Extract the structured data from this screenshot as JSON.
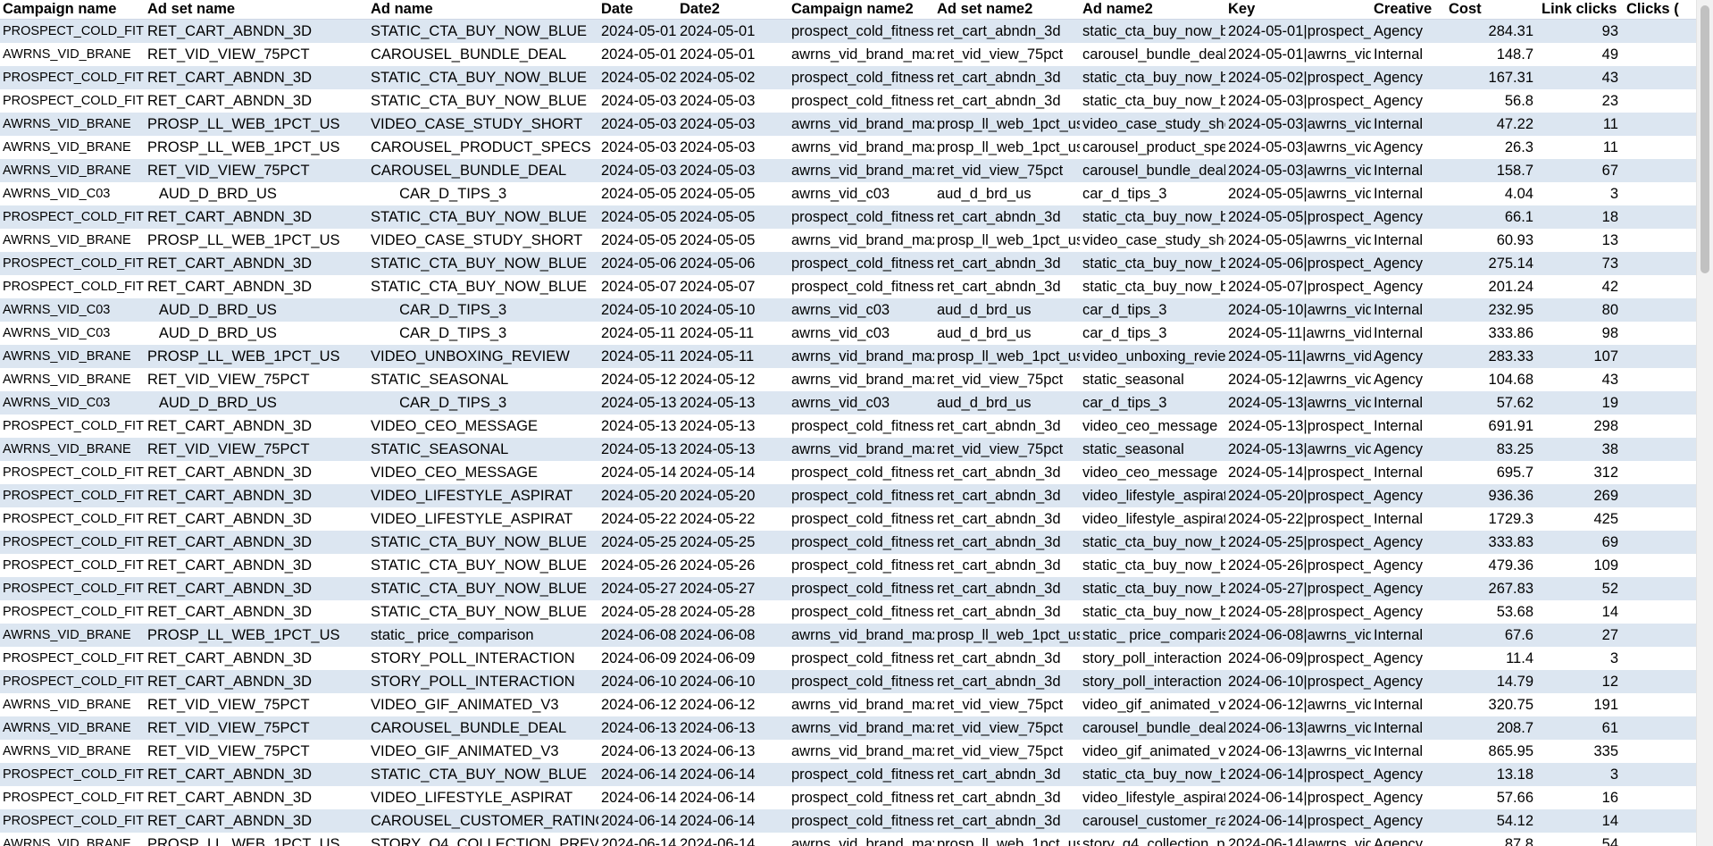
{
  "columns": [
    "Campaign name",
    "Ad set name",
    "Ad name",
    "Date",
    "Date2",
    "Campaign name2",
    "Ad set name2",
    "Ad name2",
    "Key",
    "Creative",
    "Cost",
    "Link clicks",
    "Clicks ("
  ],
  "rows": [
    [
      "PROSPECT_COLD_FITNE",
      "RET_CART_ABNDN_3D",
      "STATIC_CTA_BUY_NOW_BLUE",
      "2024-05-01",
      "2024-05-01",
      "prospect_cold_fitness",
      "ret_cart_abndn_3d",
      "static_cta_buy_now_bl",
      "2024-05-01|prospect_",
      "Agency",
      "284.31",
      "93",
      ""
    ],
    [
      "AWRNS_VID_BRANE",
      "RET_VID_VIEW_75PCT",
      "CAROUSEL_BUNDLE_DEAL",
      "2024-05-01",
      "2024-05-01",
      "awrns_vid_brand_max",
      "ret_vid_view_75pct",
      "carousel_bundle_deal",
      "2024-05-01|awrns_vid",
      "Internal",
      "148.7",
      "49",
      ""
    ],
    [
      "PROSPECT_COLD_FITNE",
      "RET_CART_ABNDN_3D",
      "STATIC_CTA_BUY_NOW_BLUE",
      "2024-05-02",
      "2024-05-02",
      "prospect_cold_fitness",
      "ret_cart_abndn_3d",
      "static_cta_buy_now_bl",
      "2024-05-02|prospect_",
      "Agency",
      "167.31",
      "43",
      ""
    ],
    [
      "PROSPECT_COLD_FITNE",
      "RET_CART_ABNDN_3D",
      "STATIC_CTA_BUY_NOW_BLUE",
      "2024-05-03",
      "2024-05-03",
      "prospect_cold_fitness",
      "ret_cart_abndn_3d",
      "static_cta_buy_now_bl",
      "2024-05-03|prospect_",
      "Agency",
      "56.8",
      "23",
      ""
    ],
    [
      "AWRNS_VID_BRANE",
      "PROSP_LL_WEB_1PCT_US",
      "VIDEO_CASE_STUDY_SHORT",
      "2024-05-03",
      "2024-05-03",
      "awrns_vid_brand_max",
      "prosp_ll_web_1pct_us",
      "video_case_study_shor",
      "2024-05-03|awrns_vid",
      "Internal",
      "47.22",
      "11",
      ""
    ],
    [
      "AWRNS_VID_BRANE",
      "PROSP_LL_WEB_1PCT_US",
      "CAROUSEL_PRODUCT_SPECS",
      "2024-05-03",
      "2024-05-03",
      "awrns_vid_brand_max",
      "prosp_ll_web_1pct_us",
      "carousel_product_spec",
      "2024-05-03|awrns_vid",
      "Agency",
      "26.3",
      "11",
      ""
    ],
    [
      "AWRNS_VID_BRANE",
      "RET_VID_VIEW_75PCT",
      "CAROUSEL_BUNDLE_DEAL",
      "2024-05-03",
      "2024-05-03",
      "awrns_vid_brand_max",
      "ret_vid_view_75pct",
      "carousel_bundle_deal",
      "2024-05-03|awrns_vid",
      "Internal",
      "158.7",
      "67",
      ""
    ],
    [
      "AWRNS_VID_C03",
      "   AUD_D_BRD_US",
      "       CAR_D_TIPS_3",
      "2024-05-05",
      "2024-05-05",
      "awrns_vid_c03",
      "aud_d_brd_us",
      "car_d_tips_3",
      "2024-05-05|awrns_vid",
      "Internal",
      "4.04",
      "3",
      ""
    ],
    [
      "PROSPECT_COLD_FITNE",
      "RET_CART_ABNDN_3D",
      "STATIC_CTA_BUY_NOW_BLUE",
      "2024-05-05",
      "2024-05-05",
      "prospect_cold_fitness",
      "ret_cart_abndn_3d",
      "static_cta_buy_now_bl",
      "2024-05-05|prospect_",
      "Agency",
      "66.1",
      "18",
      ""
    ],
    [
      "AWRNS_VID_BRANE",
      "PROSP_LL_WEB_1PCT_US",
      "VIDEO_CASE_STUDY_SHORT",
      "2024-05-05",
      "2024-05-05",
      "awrns_vid_brand_max",
      "prosp_ll_web_1pct_us",
      "video_case_study_shor",
      "2024-05-05|awrns_vid",
      "Internal",
      "60.93",
      "13",
      ""
    ],
    [
      "PROSPECT_COLD_FITNE",
      "RET_CART_ABNDN_3D",
      "STATIC_CTA_BUY_NOW_BLUE",
      "2024-05-06",
      "2024-05-06",
      "prospect_cold_fitness",
      "ret_cart_abndn_3d",
      "static_cta_buy_now_bl",
      "2024-05-06|prospect_",
      "Agency",
      "275.14",
      "73",
      ""
    ],
    [
      "PROSPECT_COLD_FITNE",
      "RET_CART_ABNDN_3D",
      "STATIC_CTA_BUY_NOW_BLUE",
      "2024-05-07",
      "2024-05-07",
      "prospect_cold_fitness",
      "ret_cart_abndn_3d",
      "static_cta_buy_now_bl",
      "2024-05-07|prospect_",
      "Agency",
      "201.24",
      "42",
      ""
    ],
    [
      "AWRNS_VID_C03",
      "   AUD_D_BRD_US",
      "       CAR_D_TIPS_3",
      "2024-05-10",
      "2024-05-10",
      "awrns_vid_c03",
      "aud_d_brd_us",
      "car_d_tips_3",
      "2024-05-10|awrns_vid",
      "Internal",
      "232.95",
      "80",
      ""
    ],
    [
      "AWRNS_VID_C03",
      "   AUD_D_BRD_US",
      "       CAR_D_TIPS_3",
      "2024-05-11",
      "2024-05-11",
      "awrns_vid_c03",
      "aud_d_brd_us",
      "car_d_tips_3",
      "2024-05-11|awrns_vid",
      "Internal",
      "333.86",
      "98",
      ""
    ],
    [
      "AWRNS_VID_BRANE",
      "PROSP_LL_WEB_1PCT_US",
      "VIDEO_UNBOXING_REVIEW",
      "2024-05-11",
      "2024-05-11",
      "awrns_vid_brand_max",
      "prosp_ll_web_1pct_us",
      "video_unboxing_reviev",
      "2024-05-11|awrns_vid",
      "Agency",
      "283.33",
      "107",
      ""
    ],
    [
      "AWRNS_VID_BRANE",
      "RET_VID_VIEW_75PCT",
      "STATIC_SEASONAL",
      "2024-05-12",
      "2024-05-12",
      "awrns_vid_brand_max",
      "ret_vid_view_75pct",
      "static_seasonal",
      "2024-05-12|awrns_vid",
      "Agency",
      "104.68",
      "43",
      ""
    ],
    [
      "AWRNS_VID_C03",
      "   AUD_D_BRD_US",
      "       CAR_D_TIPS_3",
      "2024-05-13",
      "2024-05-13",
      "awrns_vid_c03",
      "aud_d_brd_us",
      "car_d_tips_3",
      "2024-05-13|awrns_vid",
      "Internal",
      "57.62",
      "19",
      ""
    ],
    [
      "PROSPECT_COLD_FITNE",
      "RET_CART_ABNDN_3D",
      "VIDEO_CEO_MESSAGE",
      "2024-05-13",
      "2024-05-13",
      "prospect_cold_fitness",
      "ret_cart_abndn_3d",
      "video_ceo_message",
      "2024-05-13|prospect_",
      "Internal",
      "691.91",
      "298",
      ""
    ],
    [
      "AWRNS_VID_BRANE",
      "RET_VID_VIEW_75PCT",
      "STATIC_SEASONAL",
      "2024-05-13",
      "2024-05-13",
      "awrns_vid_brand_max",
      "ret_vid_view_75pct",
      "static_seasonal",
      "2024-05-13|awrns_vid",
      "Agency",
      "83.25",
      "38",
      ""
    ],
    [
      "PROSPECT_COLD_FITNE",
      "RET_CART_ABNDN_3D",
      "VIDEO_CEO_MESSAGE",
      "2024-05-14",
      "2024-05-14",
      "prospect_cold_fitness",
      "ret_cart_abndn_3d",
      "video_ceo_message",
      "2024-05-14|prospect_",
      "Internal",
      "695.7",
      "312",
      ""
    ],
    [
      "PROSPECT_COLD_FITNE",
      "RET_CART_ABNDN_3D",
      "VIDEO_LIFESTYLE_ASPIRAT",
      "2024-05-20",
      "2024-05-20",
      "prospect_cold_fitness",
      "ret_cart_abndn_3d",
      "video_lifestyle_aspirat",
      "2024-05-20|prospect_",
      "Agency",
      "936.36",
      "269",
      ""
    ],
    [
      "PROSPECT_COLD_FITNE",
      "RET_CART_ABNDN_3D",
      "VIDEO_LIFESTYLE_ASPIRAT",
      "2024-05-22",
      "2024-05-22",
      "prospect_cold_fitness",
      "ret_cart_abndn_3d",
      "video_lifestyle_aspirat",
      "2024-05-22|prospect_",
      "Internal",
      "1729.3",
      "425",
      ""
    ],
    [
      "PROSPECT_COLD_FITNE",
      "RET_CART_ABNDN_3D",
      "STATIC_CTA_BUY_NOW_BLUE",
      "2024-05-25",
      "2024-05-25",
      "prospect_cold_fitness",
      "ret_cart_abndn_3d",
      "static_cta_buy_now_bl",
      "2024-05-25|prospect_",
      "Agency",
      "333.83",
      "69",
      ""
    ],
    [
      "PROSPECT_COLD_FITNE",
      "RET_CART_ABNDN_3D",
      "STATIC_CTA_BUY_NOW_BLUE",
      "2024-05-26",
      "2024-05-26",
      "prospect_cold_fitness",
      "ret_cart_abndn_3d",
      "static_cta_buy_now_bl",
      "2024-05-26|prospect_",
      "Agency",
      "479.36",
      "109",
      ""
    ],
    [
      "PROSPECT_COLD_FITNE",
      "RET_CART_ABNDN_3D",
      "STATIC_CTA_BUY_NOW_BLUE",
      "2024-05-27",
      "2024-05-27",
      "prospect_cold_fitness",
      "ret_cart_abndn_3d",
      "static_cta_buy_now_bl",
      "2024-05-27|prospect_",
      "Agency",
      "267.83",
      "52",
      ""
    ],
    [
      "PROSPECT_COLD_FITNE",
      "RET_CART_ABNDN_3D",
      "STATIC_CTA_BUY_NOW_BLUE",
      "2024-05-28",
      "2024-05-28",
      "prospect_cold_fitness",
      "ret_cart_abndn_3d",
      "static_cta_buy_now_bl",
      "2024-05-28|prospect_",
      "Agency",
      "53.68",
      "14",
      ""
    ],
    [
      "AWRNS_VID_BRANE",
      "PROSP_LL_WEB_1PCT_US",
      "static_ price_comparison",
      "2024-06-08",
      "2024-06-08",
      "awrns_vid_brand_max",
      "prosp_ll_web_1pct_us",
      "static_ price_comparis",
      "2024-06-08|awrns_vid",
      "Internal",
      "67.6",
      "27",
      ""
    ],
    [
      "PROSPECT_COLD_FITNE",
      "RET_CART_ABNDN_3D",
      "STORY_POLL_INTERACTION",
      "2024-06-09",
      "2024-06-09",
      "prospect_cold_fitness",
      "ret_cart_abndn_3d",
      "story_poll_interaction",
      "2024-06-09|prospect_",
      "Agency",
      "11.4",
      "3",
      ""
    ],
    [
      "PROSPECT_COLD_FITNE",
      "RET_CART_ABNDN_3D",
      "STORY_POLL_INTERACTION",
      "2024-06-10",
      "2024-06-10",
      "prospect_cold_fitness",
      "ret_cart_abndn_3d",
      "story_poll_interaction",
      "2024-06-10|prospect_",
      "Agency",
      "14.79",
      "12",
      ""
    ],
    [
      "AWRNS_VID_BRANE",
      "RET_VID_VIEW_75PCT",
      "VIDEO_GIF_ANIMATED_V3",
      "2024-06-12",
      "2024-06-12",
      "awrns_vid_brand_max",
      "ret_vid_view_75pct",
      "video_gif_animated_v3",
      "2024-06-12|awrns_vid",
      "Internal",
      "320.75",
      "191",
      ""
    ],
    [
      "AWRNS_VID_BRANE",
      "RET_VID_VIEW_75PCT",
      "CAROUSEL_BUNDLE_DEAL",
      "2024-06-13",
      "2024-06-13",
      "awrns_vid_brand_max",
      "ret_vid_view_75pct",
      "carousel_bundle_deal",
      "2024-06-13|awrns_vid",
      "Internal",
      "208.7",
      "61",
      ""
    ],
    [
      "AWRNS_VID_BRANE",
      "RET_VID_VIEW_75PCT",
      "VIDEO_GIF_ANIMATED_V3",
      "2024-06-13",
      "2024-06-13",
      "awrns_vid_brand_max",
      "ret_vid_view_75pct",
      "video_gif_animated_v3",
      "2024-06-13|awrns_vid",
      "Internal",
      "865.95",
      "335",
      ""
    ],
    [
      "PROSPECT_COLD_FITNE",
      "RET_CART_ABNDN_3D",
      "STATIC_CTA_BUY_NOW_BLUE",
      "2024-06-14",
      "2024-06-14",
      "prospect_cold_fitness",
      "ret_cart_abndn_3d",
      "static_cta_buy_now_bl",
      "2024-06-14|prospect_",
      "Agency",
      "13.18",
      "3",
      ""
    ],
    [
      "PROSPECT_COLD_FITNE",
      "RET_CART_ABNDN_3D",
      "VIDEO_LIFESTYLE_ASPIRAT",
      "2024-06-14",
      "2024-06-14",
      "prospect_cold_fitness",
      "ret_cart_abndn_3d",
      "video_lifestyle_aspirat",
      "2024-06-14|prospect_",
      "Agency",
      "57.66",
      "16",
      ""
    ],
    [
      "PROSPECT_COLD_FITNE",
      "RET_CART_ABNDN_3D",
      "CAROUSEL_CUSTOMER_RATING",
      "2024-06-14",
      "2024-06-14",
      "prospect_cold_fitness",
      "ret_cart_abndn_3d",
      "carousel_customer_rat",
      "2024-06-14|prospect_",
      "Agency",
      "54.12",
      "14",
      ""
    ],
    [
      "AWRNS_VID_BRANE",
      "PROSP_LL_WEB_1PCT_US",
      "STORY_Q4_COLLECTION_PREV",
      "2024-06-14",
      "2024-06-14",
      "awrns_vid_brand_max",
      "prosp_ll_web_1pct_us",
      "story_q4_collection_p",
      "2024-06-14|awrns_vid",
      "Agency",
      "87.8",
      "54",
      ""
    ]
  ]
}
